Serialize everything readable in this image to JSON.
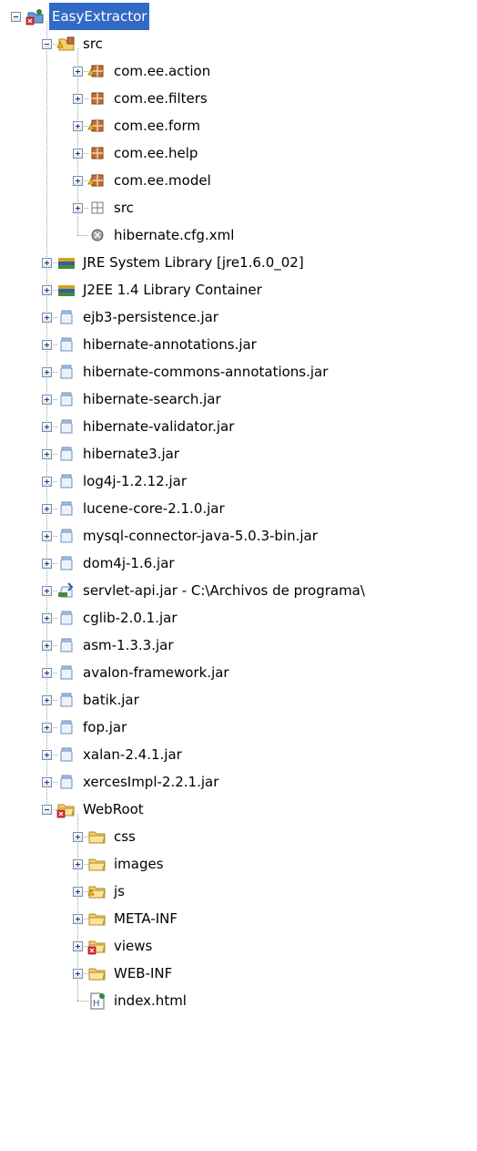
{
  "tree": {
    "items": [
      {
        "label": "EasyExtractor",
        "icon": "project-error-icon",
        "depth": 0,
        "state": "collapse",
        "selected": true
      },
      {
        "label": "src",
        "icon": "source-folder-warning-icon",
        "depth": 1,
        "state": "collapse"
      },
      {
        "label": "com.ee.action",
        "icon": "package-warning-icon",
        "depth": 2,
        "state": "expand"
      },
      {
        "label": "com.ee.filters",
        "icon": "package-icon",
        "depth": 2,
        "state": "expand"
      },
      {
        "label": "com.ee.form",
        "icon": "package-warning-icon",
        "depth": 2,
        "state": "expand"
      },
      {
        "label": "com.ee.help",
        "icon": "package-icon",
        "depth": 2,
        "state": "expand"
      },
      {
        "label": "com.ee.model",
        "icon": "package-warning-icon",
        "depth": 2,
        "state": "expand"
      },
      {
        "label": "src",
        "icon": "empty-package-icon",
        "depth": 2,
        "state": "expand"
      },
      {
        "label": "hibernate.cfg.xml",
        "icon": "xml-file-icon",
        "depth": 2,
        "state": "leaf"
      },
      {
        "label": "JRE System Library [jre1.6.0_02]",
        "icon": "library-icon",
        "depth": 1,
        "state": "expand"
      },
      {
        "label": "J2EE 1.4 Library Container",
        "icon": "library-icon",
        "depth": 1,
        "state": "expand"
      },
      {
        "label": "ejb3-persistence.jar",
        "icon": "jar-icon",
        "depth": 1,
        "state": "expand"
      },
      {
        "label": "hibernate-annotations.jar",
        "icon": "jar-icon",
        "depth": 1,
        "state": "expand"
      },
      {
        "label": "hibernate-commons-annotations.jar",
        "icon": "jar-icon",
        "depth": 1,
        "state": "expand"
      },
      {
        "label": "hibernate-search.jar",
        "icon": "jar-icon",
        "depth": 1,
        "state": "expand"
      },
      {
        "label": "hibernate-validator.jar",
        "icon": "jar-icon",
        "depth": 1,
        "state": "expand"
      },
      {
        "label": "hibernate3.jar",
        "icon": "jar-icon",
        "depth": 1,
        "state": "expand"
      },
      {
        "label": "log4j-1.2.12.jar",
        "icon": "jar-icon",
        "depth": 1,
        "state": "expand"
      },
      {
        "label": "lucene-core-2.1.0.jar",
        "icon": "jar-icon",
        "depth": 1,
        "state": "expand"
      },
      {
        "label": "mysql-connector-java-5.0.3-bin.jar",
        "icon": "jar-icon",
        "depth": 1,
        "state": "expand"
      },
      {
        "label": "dom4j-1.6.jar",
        "icon": "jar-icon",
        "depth": 1,
        "state": "expand"
      },
      {
        "label": "servlet-api.jar - C:\\Archivos de programa\\",
        "icon": "external-jar-icon",
        "depth": 1,
        "state": "expand"
      },
      {
        "label": "cglib-2.0.1.jar",
        "icon": "jar-icon",
        "depth": 1,
        "state": "expand"
      },
      {
        "label": "asm-1.3.3.jar",
        "icon": "jar-icon",
        "depth": 1,
        "state": "expand"
      },
      {
        "label": "avalon-framework.jar",
        "icon": "jar-icon",
        "depth": 1,
        "state": "expand"
      },
      {
        "label": "batik.jar",
        "icon": "jar-icon",
        "depth": 1,
        "state": "expand"
      },
      {
        "label": "fop.jar",
        "icon": "jar-icon",
        "depth": 1,
        "state": "expand"
      },
      {
        "label": "xalan-2.4.1.jar",
        "icon": "jar-icon",
        "depth": 1,
        "state": "expand"
      },
      {
        "label": "xercesImpl-2.2.1.jar",
        "icon": "jar-icon",
        "depth": 1,
        "state": "expand"
      },
      {
        "label": "WebRoot",
        "icon": "folder-error-icon",
        "depth": 1,
        "state": "collapse"
      },
      {
        "label": "css",
        "icon": "folder-icon",
        "depth": 2,
        "state": "expand"
      },
      {
        "label": "images",
        "icon": "folder-icon",
        "depth": 2,
        "state": "expand"
      },
      {
        "label": "js",
        "icon": "folder-warning-icon",
        "depth": 2,
        "state": "expand"
      },
      {
        "label": "META-INF",
        "icon": "folder-icon",
        "depth": 2,
        "state": "expand"
      },
      {
        "label": "views",
        "icon": "folder-error-icon",
        "depth": 2,
        "state": "expand"
      },
      {
        "label": "WEB-INF",
        "icon": "folder-icon",
        "depth": 2,
        "state": "expand"
      },
      {
        "label": "index.html",
        "icon": "html-file-icon",
        "depth": 2,
        "state": "leaf"
      }
    ]
  },
  "colors": {
    "selection": "#3169c6",
    "folder": "#f4cf6a",
    "package": "#c0703a",
    "warning": "#f2c200",
    "error": "#e03030",
    "jar": "#a9c4e8"
  }
}
